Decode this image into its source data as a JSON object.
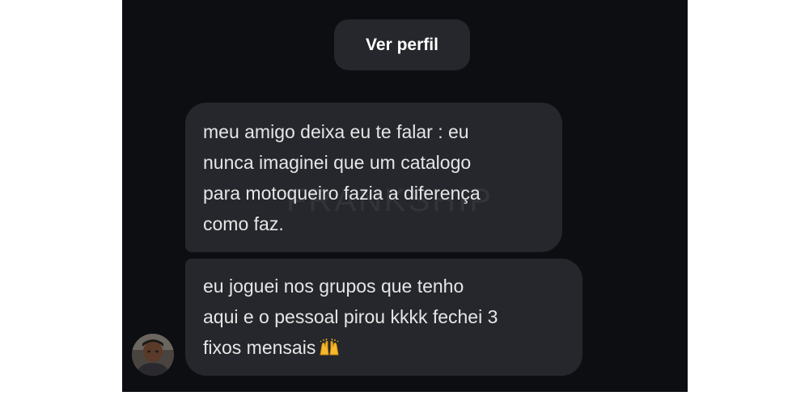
{
  "header": {
    "profile_button_label": "Ver perfil"
  },
  "messages": [
    {
      "text": "meu amigo deixa eu te falar : eu\nnunca imaginei que um catalogo\npara motoqueiro fazia a diferença\ncomo faz.",
      "watermark": "FRANKSHIP"
    },
    {
      "text": "eu joguei nos grupos que tenho\naqui e o pessoal pirou kkkk fechei 3\nfixos mensais",
      "emoji": "raising-hands-emoji"
    }
  ],
  "sender": {
    "avatar_icon": "profile-photo"
  },
  "colors": {
    "background": "#0c0e12",
    "bubble": "#25272c",
    "text": "#e6e6e6",
    "button_text": "#ffffff",
    "emoji": "#f5b92e"
  }
}
